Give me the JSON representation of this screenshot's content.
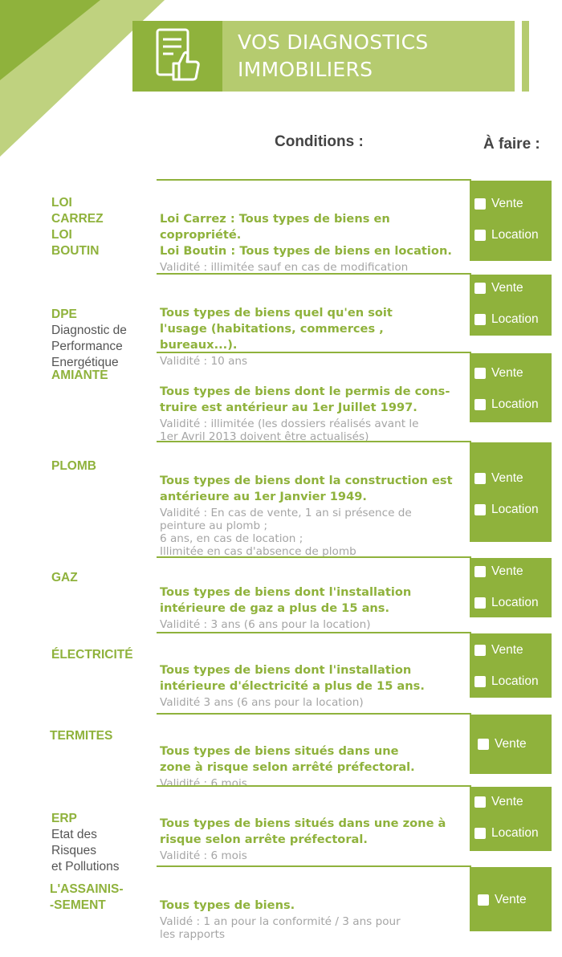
{
  "header": {
    "title": "VOS DIAGNOSTICS\nIMMOBILIERS",
    "icon": "document-thumbs-up-icon"
  },
  "columns": {
    "conditions": "Conditions :",
    "todo": "À faire :"
  },
  "colors": {
    "green": "#8fb23c",
    "light_green": "#b5cb6f",
    "grey_text": "#a5a5a5"
  },
  "rows": [
    {
      "label": "LOI\nCARREZ\nLOI\nBOUTIN",
      "sublabel": "",
      "condition": "Loi Carrez : Tous types de biens en\ncopropriété.\nLoi Boutin : Tous types de biens en location.",
      "validity": "Validité : illimitée sauf en cas de modification",
      "options": [
        "Vente",
        "Location"
      ]
    },
    {
      "label": "DPE",
      "sublabel": "Diagnostic de\nPerformance\nEnergétique",
      "condition": "Tous types de biens quel qu'en soit\nl'usage (habitations, commerces , bureaux...).",
      "validity": "Validité : 10 ans",
      "options": [
        "Vente",
        "Location"
      ]
    },
    {
      "label": "AMIANTE",
      "sublabel": "",
      "condition": "Tous types de biens dont le permis de cons-\ntruire est antérieur au 1er Juillet 1997.",
      "validity": "Validité : illimitée (les dossiers réalisés avant le\n1er Avril 2013 doivent être actualisés)",
      "options": [
        "Vente",
        "Location"
      ]
    },
    {
      "label": "PLOMB",
      "sublabel": "",
      "condition": "Tous types de biens dont la construction est\nantérieure au 1er Janvier 1949.",
      "validity": "Validité : En cas de vente, 1 an si présence de\npeinture au plomb ;\n6 ans, en cas de location ;\nIllimitée en cas d'absence de plomb",
      "options": [
        "Vente",
        "Location"
      ]
    },
    {
      "label": "GAZ",
      "sublabel": "",
      "condition": "Tous types de biens dont l'installation\nintérieure de gaz a plus de 15 ans.",
      "validity": "Validité : 3 ans (6 ans pour la location)",
      "options": [
        "Vente",
        "Location"
      ]
    },
    {
      "label": "ÉLECTRICITÉ",
      "sublabel": "",
      "condition": "Tous types de biens dont l'installation\nintérieure d'électricité a plus de 15 ans.",
      "validity": "Validité 3 ans (6 ans pour la location)",
      "options": [
        "Vente",
        "Location"
      ]
    },
    {
      "label": "TERMITES",
      "sublabel": "",
      "condition": "Tous types de biens situés dans une\nzone à risque selon arrêté préfectoral.",
      "validity": "Validité : 6 mois",
      "options": [
        "Vente"
      ]
    },
    {
      "label": "ERP",
      "sublabel": "Etat des\nRisques\net Pollutions",
      "condition": "Tous types de biens situés dans une zone à\nrisque selon arrête préfectoral.",
      "validity": "Validité : 6 mois",
      "options": [
        "Vente",
        "Location"
      ]
    },
    {
      "label": "L'ASSAINIS-\n-SEMENT",
      "sublabel": "",
      "condition": "Tous types de biens.",
      "validity": "Validé : 1 an pour la conformité / 3 ans pour\nles rapports",
      "options": [
        "Vente"
      ]
    }
  ]
}
